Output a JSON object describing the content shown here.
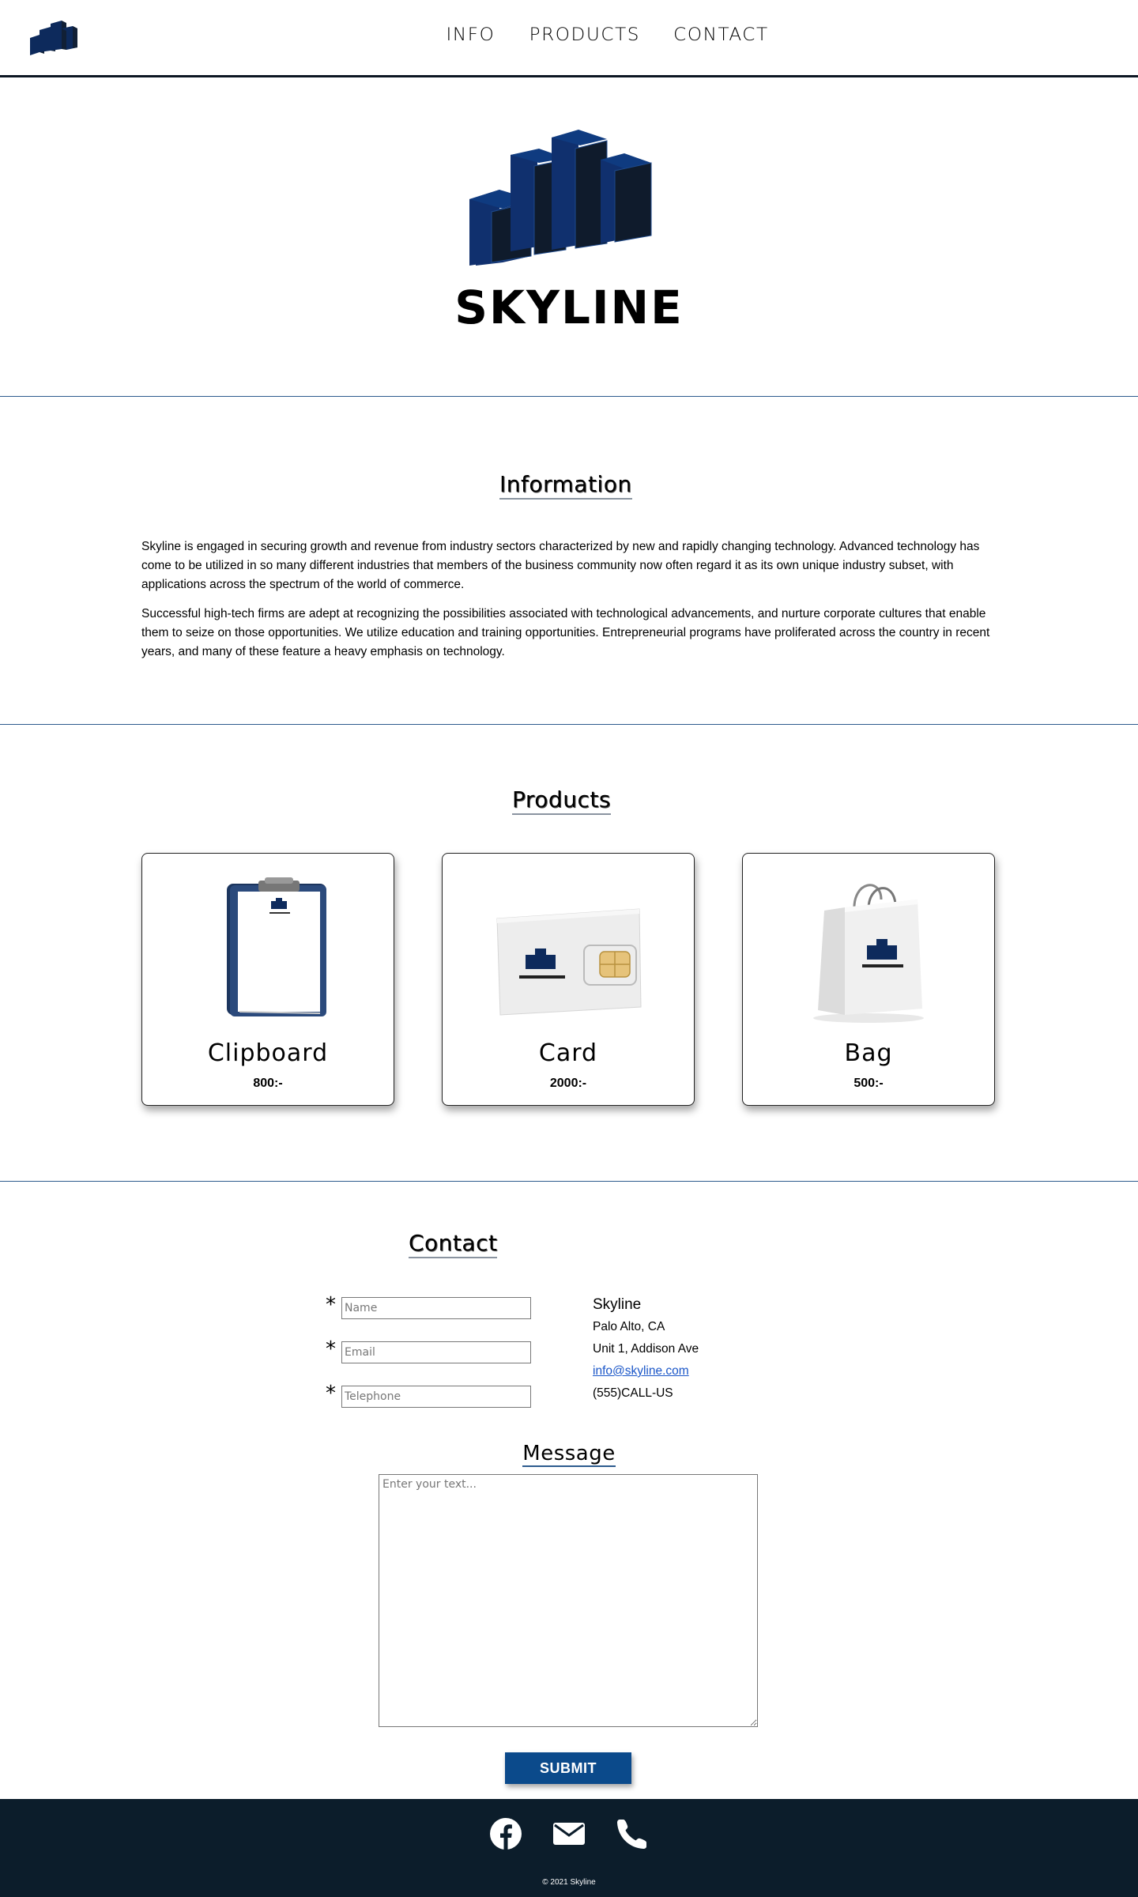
{
  "nav": {
    "logo_icon": "skyline-buildings-logo-icon",
    "links": [
      "INFO",
      "PRODUCTS",
      "CONTACT"
    ]
  },
  "hero": {
    "logo_icon": "skyline-buildings-logo-icon",
    "title": "SKYLINE"
  },
  "info": {
    "title": "Information",
    "paragraphs": [
      "Skyline is engaged in securing growth and revenue from industry sectors characterized by new and rapidly changing technology. Advanced technology has come to be utilized in so many different industries that members of the business community now often regard it as its own unique industry subset, with applications across the spectrum of the world of commerce.",
      "Successful high-tech firms are adept at recognizing the possibilities associated with technological advancements, and nurture corporate cultures that enable them to seize on those opportunities. We utilize education and training opportunities. Entrepreneurial programs have proliferated across the country in recent years, and many of these feature a heavy emphasis on technology."
    ]
  },
  "products": {
    "title": "Products",
    "items": [
      {
        "name": "Clipboard",
        "price": "800:-",
        "image": "clipboard-product-image"
      },
      {
        "name": "Card",
        "price": "2000:-",
        "image": "sim-card-product-image"
      },
      {
        "name": "Bag",
        "price": "500:-",
        "image": "shopping-bag-product-image"
      }
    ]
  },
  "contact": {
    "title": "Contact",
    "required_mark": "*",
    "fields": {
      "name_placeholder": "Name",
      "email_placeholder": "Email",
      "telephone_placeholder": "Telephone"
    },
    "address": {
      "name": "Skyline",
      "line1": "Palo Alto, CA",
      "line2": "Unit 1, Addison Ave",
      "email": "info@skyline.com",
      "phone": "(555)CALL-US"
    },
    "message_title": "Message",
    "message_placeholder": "Enter your text...",
    "submit_label": "SUBMIT"
  },
  "footer": {
    "icons": [
      "facebook-icon",
      "mail-icon",
      "phone-icon"
    ],
    "copyright": "© 2021 Skyline"
  },
  "colors": {
    "brand_navy": "#0c1d2b",
    "building_blue": "#0d2a5c",
    "submit_blue": "#0b4a8b",
    "divider_blue": "#2d5b8e",
    "link_blue": "#1a56c8"
  }
}
